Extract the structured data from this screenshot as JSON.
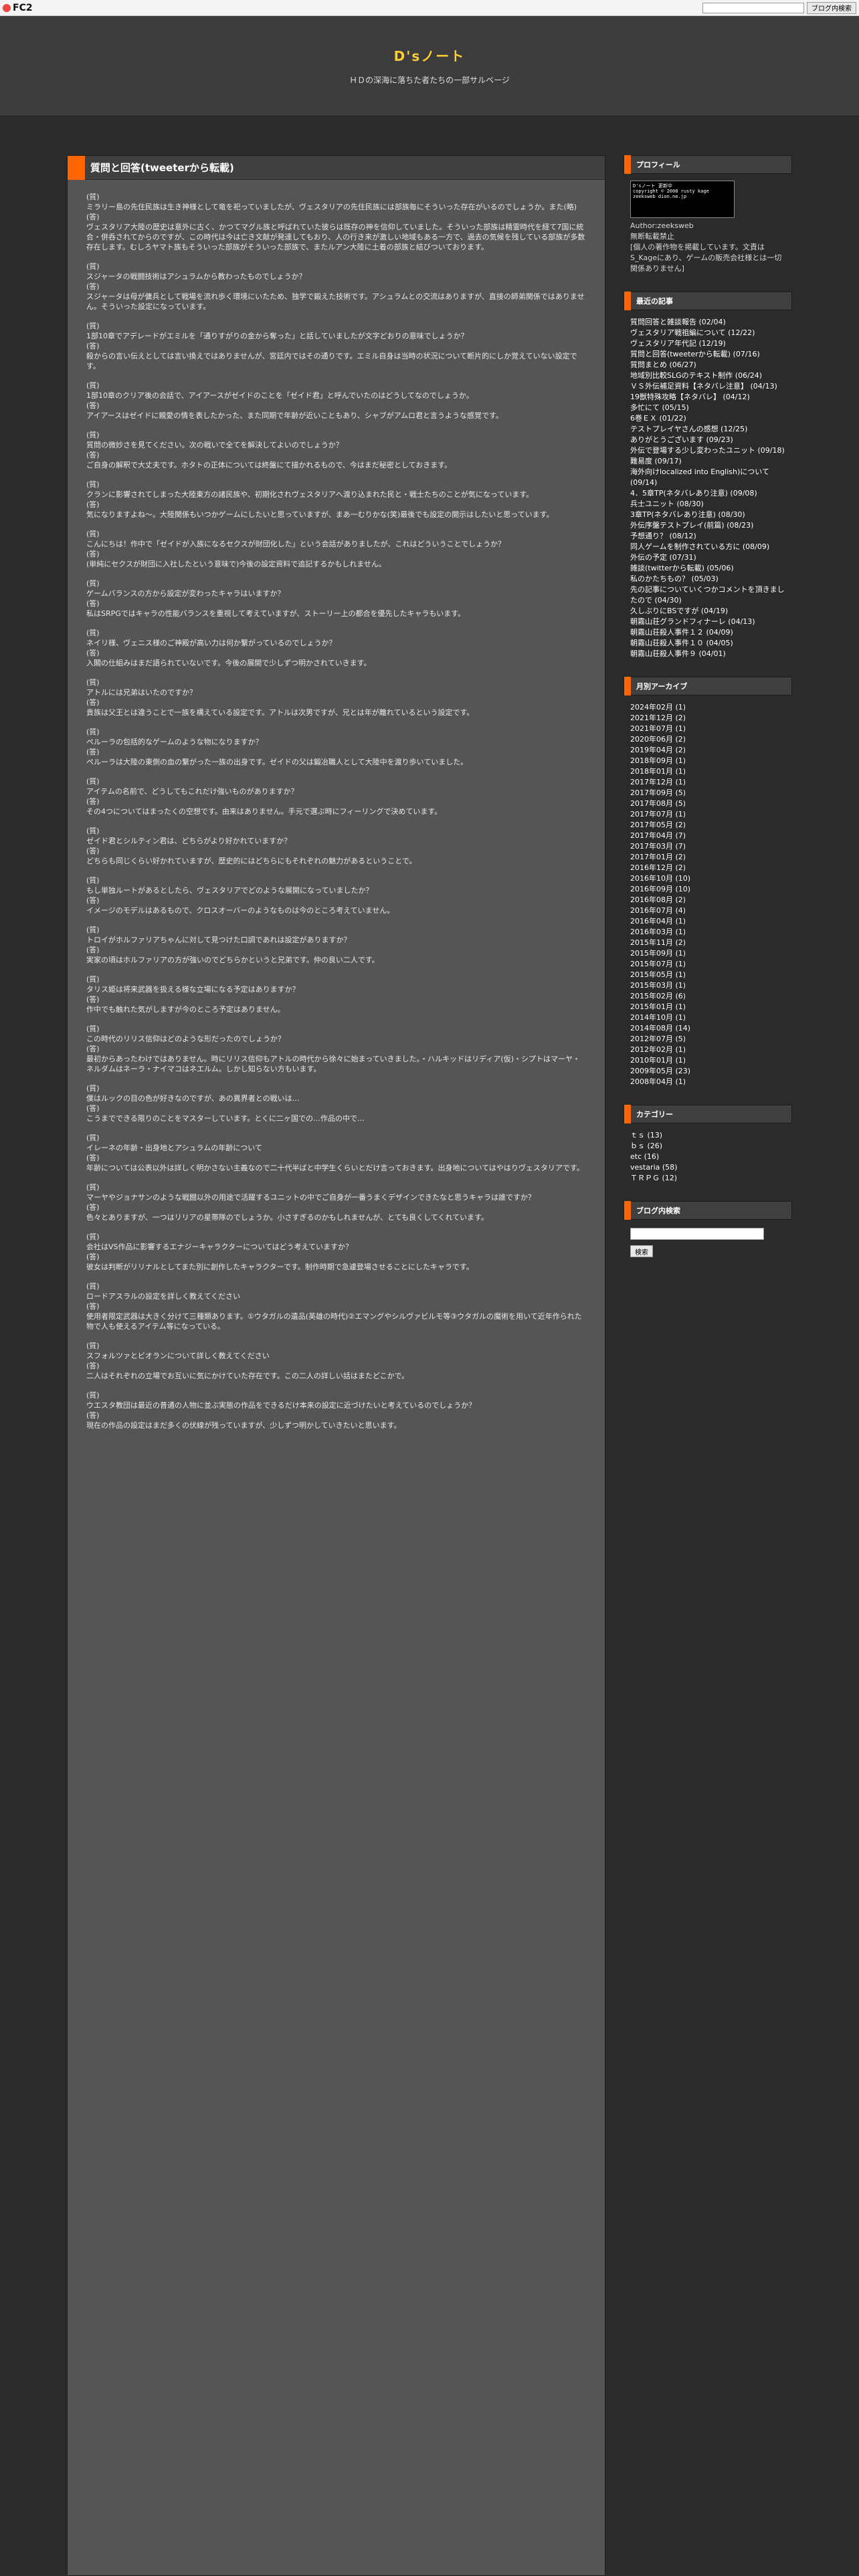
{
  "fc2": {
    "logo": "FC2",
    "search_button": "ブログ内検索"
  },
  "header": {
    "title": "D'sノート",
    "subtitle": "ＨＤの深海に落ちた者たちの一部サルベージ"
  },
  "entry": {
    "title": "質問と回答(tweeterから転載)",
    "qa": [
      {
        "q": "ミラリー島の先住民族は生き神様として竜を祀っていましたが、ヴェスタリアの先住民族には部族毎にそういった存在がいるのでしょうか。また(略)",
        "a": "ヴェスタリア大陸の歴史は意外に古く、かつてマグル族と呼ばれていた彼らは既存の神を信仰していました。そういった部族は精霊時代を経て7国に統合・併呑されてからのですが、この時代は今は亡き文献が発達してもおり、人の行き来が激しい地域もある一方で、過去の気候を残している部族が多数存在します。むしろヤマト族もそういった部族がそういった部族で、またルアン大陸に土着の部族と結びついております。"
      },
      {
        "q": "スジャータの戦闘技術はアシュラムから教わったものでしょうか？",
        "a": "スジャータは母が傭兵として戦場を流れ歩く環境にいたため、独学で鍛えた技術です。アシュラムとの交流はありますが、直接の師弟関係ではありません。そういった設定になっています。"
      },
      {
        "q": "1部10章でアデレードがエミルを「通りすがりの金から奪った」と話していましたが文字どおりの意味でしょうか？",
        "a": "殺からの言い伝えとしては言い換えではありませんが、宮廷内ではその通りです。エミル自身は当時の状況について断片的にしか覚えていない設定です。"
      },
      {
        "q": "1部10章のクリア後の会話で、アイアースがゼイドのことを「ゼイド君」と呼んでいたのはどうしてなのでしょうか。",
        "a": "アイアースはゼイドに親愛の情を表したかった、また同期で年齢が近いこともあり、シャブがアムロ君と言うような感覚です。"
      },
      {
        "q": "質問の微妙さを見てください。次の戦いで全てを解決してよいのでしょうか？",
        "a": "ご自身の解釈で大丈夫です。ホタトの正体については終盤にて描かれるもので、今はまだ秘密としておきます。"
      },
      {
        "q": "クランに影響されてしまった大陸東方の諸民族や、初期化されヴェスタリアへ渡り込まれた民と・戦士たちのことが気になっています。",
        "a": "気になりますよね〜。大陸関係もいつかゲームにしたいと思っていますが、まあ一むりかな(笑)最後でも設定の開示はしたいと思っています。"
      },
      {
        "q": "こんにちは！作中で「ゼイドが入族になるセクスが財団化した」という会話がありましたが、これはどういうことでしょうか？",
        "a": "(単純にセクスが財団に入社したという意味で)今後の設定資料で追記するかもしれません。"
      },
      {
        "q": "ゲームバランスの方から設定が変わったキャラはいますか？",
        "a": "私はSRPGではキャラの性能バランスを重視して考えていますが、ストーリー上の都合を優先したキャラもいます。"
      },
      {
        "q": "ネイリ様、ヴェニス様のご神殿が高い力は何か繋がっているのでしょうか？",
        "a": "入閣の仕組みはまだ語られていないです。今後の展開で少しずつ明かされていきます。"
      },
      {
        "q": "アトルには兄弟はいたのですか？",
        "a": "貴族は父王とは違うことで一族を構えている設定です。アトルは次男ですが、兄とは年が離れているという設定です。"
      },
      {
        "q": "ペルーラの包括的なゲームのような物になりますか？",
        "a": "ペルーラは大陸の東側の血の繋がった一族の出身です。ゼイドの父は鍛冶職人として大陸中を渡り歩いていました。"
      },
      {
        "q": "アイテムの名前で、どうしてもこれだけ強いものがありますか？",
        "a": "その4つについてはまったくの空想です。由来はありません。手元で選ぶ時にフィーリングで決めています。"
      },
      {
        "q": "ゼイド君とシルティン君は、どちらがより好かれていますか？",
        "a": "どちらも同じくらい好かれていますが、歴史的にはどちらにもそれぞれの魅力があるということで。"
      },
      {
        "q": "もし単独ルートがあるとしたら、ヴェスタリアでどのような展開になっていましたか？",
        "a": "イメージのモデルはあるもので、クロスオーバーのようなものは今のところ考えていません。"
      },
      {
        "q": "トロイがホルファリアちゃんに対して見つけた口調であれは設定がありますか？",
        "a": "実家の頃はホルファリアの方が強いのでどちらかというと兄弟です。仲の良い二人です。"
      },
      {
        "q": "タリス姫は将来武器を扱える様な立場になる予定はありますか？",
        "a": "作中でも触れた気がしますが今のところ予定はありません。"
      },
      {
        "q": "この時代のリリス信仰はどのような形だったのでしょうか？",
        "a": "最初からあったわけではありません。時にリリス信仰もアトルの時代から徐々に始まっていきました。・ハルキッドはリディア(仮)・シプトはマーヤ・ネルダムはネーラ・ナイマコはネエルム。しかし知らない方もいます。"
      },
      {
        "q": "僕はルックの目の色が好きなのですが、あの異界者との戦いは…",
        "a": "こうまでできる限りのことをマスターしています。とくに二ヶ国での…作品の中で…"
      },
      {
        "q": "イレーネの年齢・出身地とアシュラムの年齢について",
        "a": "年齢については公表以外は詳しく明かさない主義なので二十代半ばと中学生くらいとだけ言っておきます。出身地についてはやはりヴェスタリアです。"
      },
      {
        "q": "マーヤやジョナサンのような戦闘以外の用途で活躍するユニットの中でご自身が一番うまくデザインできたなと思うキャラは誰ですか？",
        "a": "色々とありますが、一つはリリアの星帯隊のでしょうか。小さすぎるのかもしれませんが、とても良くしてくれています。"
      },
      {
        "q": "会社はVS作品に影響するエナジーキャラクターについてはどう考えていますか？",
        "a": "彼女は判断がリリナルとしてまた別に創作したキャラクターです。制作時期で急遽登場させることにしたキャラです。"
      },
      {
        "q": "ロードアスラルの設定を詳しく教えてください",
        "a": "使用者限定武器は大きく分けて三種類あります。①ウタガルの遺品(英雄の時代)②エマングやシルヴァビルモ等③ウタガルの魔術を用いて近年作られた物で人も使えるアイテム等になっている。"
      },
      {
        "q": "スフォルツァとビオランについて詳しく教えてください",
        "a": "二人はそれぞれの立場でお互いに気にかけていた存在です。この二人の詳しい話はまたどこかで。"
      },
      {
        "q": "ウエスタ教団は最近の普通の人物に並ぶ実態の作品をできるだけ本来の設定に近づけたいと考えているのでしょうか？",
        "a": "現在の作品の設定はまだ多くの伏線が残っていますが、少しずつ明かしていきたいと思います。"
      }
    ]
  },
  "profile": {
    "title": "プロフィール",
    "img_text": [
      "D'sノート 更新中",
      "copyright © 2008 rusty kage",
      "zeeksweb dion.ne.jp"
    ],
    "author": "Author:zeeksweb",
    "notice": "無断転載禁止",
    "desc": "[個人の著作物を掲載しています。文責は S_Kageにあり、ゲームの販売会社様とは一切関係ありません]"
  },
  "recent": {
    "title": "最近の記事",
    "items": [
      "質問回答と雑談報告 (02/04)",
      "ヴェスタリア戦祖編について (12/22)",
      "ヴェスタリア年代記 (12/19)",
      "質問と回答(tweeterから転載) (07/16)",
      "質問まとめ (06/27)",
      "地域別比較SLGのテキスト制作 (06/24)",
      "ＶＳ外伝補足資料【ネタバレ注意】 (04/13)",
      "19獣特殊攻略【ネタバレ】 (04/12)",
      "多忙にて (05/15)",
      "6巻ＥＸ (01/22)",
      "テストプレイヤさんの感想 (12/25)",
      "ありがとうございます (09/23)",
      "外伝で登場する少し変わったユニット (09/18)",
      "難易度 (09/17)",
      "海外向けlocalized into English)について (09/14)",
      "4．5章TP(ネタバレあり注意) (09/08)",
      "兵士ユニット (08/30)",
      "3章TP(ネタバレあり注意) (08/30)",
      "外伝序盤テストプレイ(前篇) (08/23)",
      "予想通り？ (08/12)",
      "同人ゲームを制作されている方に (08/09)",
      "外伝の予定 (07/31)",
      "雑談(twitterから転載) (05/06)",
      "私のかたちもの？ (05/03)",
      "先の記事についていくつかコメントを頂きましたので (04/30)",
      "久しぶりにBSですが (04/19)",
      "朝霧山荘グランドフィナーレ (04/13)",
      "朝霧山荘殺人事件１２ (04/09)",
      "朝霧山荘殺人事件１０ (04/05)",
      "朝霧山荘殺人事件９ (04/01)"
    ]
  },
  "archive": {
    "title": "月別アーカイブ",
    "items": [
      "2024年02月 (1)",
      "2021年12月 (2)",
      "2021年07月 (1)",
      "2020年06月 (2)",
      "2019年04月 (2)",
      "2018年09月 (1)",
      "2018年01月 (1)",
      "2017年12月 (1)",
      "2017年09月 (5)",
      "2017年08月 (5)",
      "2017年07月 (1)",
      "2017年05月 (2)",
      "2017年04月 (7)",
      "2017年03月 (7)",
      "2017年01月 (2)",
      "2016年12月 (2)",
      "2016年10月 (10)",
      "2016年09月 (10)",
      "2016年08月 (2)",
      "2016年07月 (4)",
      "2016年04月 (1)",
      "2016年03月 (1)",
      "2015年11月 (2)",
      "2015年09月 (1)",
      "2015年07月 (1)",
      "2015年05月 (1)",
      "2015年03月 (1)",
      "2015年02月 (6)",
      "2015年01月 (1)",
      "2014年10月 (1)",
      "2014年08月 (14)",
      "2012年07月 (5)",
      "2012年02月 (1)",
      "2010年01月 (1)",
      "2009年05月 (23)",
      "2008年04月 (1)"
    ]
  },
  "category": {
    "title": "カテゴリー",
    "items": [
      "ｔｓ (13)",
      "ｂｓ (26)",
      "etc (16)",
      "vestaria (58)",
      "ＴＲＰＧ (12)"
    ]
  },
  "blogsearch": {
    "title": "ブログ内検索",
    "button": "検索"
  }
}
